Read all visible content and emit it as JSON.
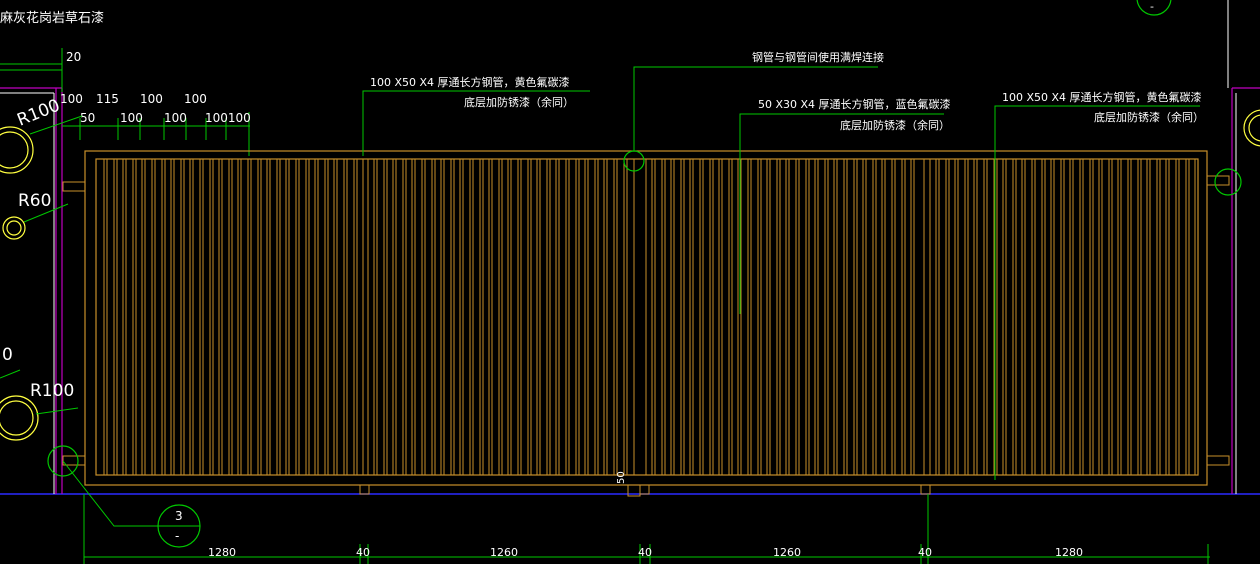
{
  "colors": {
    "background": "#000000",
    "gate": "#c8902a",
    "leader": "#00c800",
    "text": "#ffffff",
    "ground": "#2a2aff",
    "pillar": "#c000c0",
    "accent": "#ffff40"
  },
  "title_fragment": "麻灰花岗岩草石漆",
  "top_dims": {
    "dim20": "20",
    "row1": [
      "100",
      "115",
      "100",
      "100"
    ],
    "row2": [
      "50",
      "100",
      "100",
      "100100"
    ]
  },
  "radius_labels": {
    "r100_top": "R100",
    "r60": "R60",
    "zero": "0",
    "r100_bottom": "R100"
  },
  "notes": {
    "weld": "钢管与钢管间使用满焊连接",
    "left_line1": "100 X50 X4 厚通长方钢管，黄色氟碳漆",
    "left_line2": "底层加防锈漆（余同）",
    "mid_line1": "50 X30 X4 厚通长方钢管，蓝色氟碳漆",
    "mid_line2": "底层加防锈漆（余同）",
    "right_line1": "100 X50 X4 厚通长方钢管，黄色氟碳漆",
    "right_line2": "底层加防锈漆（余同）"
  },
  "gap_label": "50",
  "detail_bubble": {
    "top": "3",
    "bottom": "-"
  },
  "top_bubble": {
    "bottom": "-"
  },
  "bottom_dims": [
    "1280",
    "40",
    "1260",
    "40",
    "1260",
    "40",
    "1280"
  ]
}
